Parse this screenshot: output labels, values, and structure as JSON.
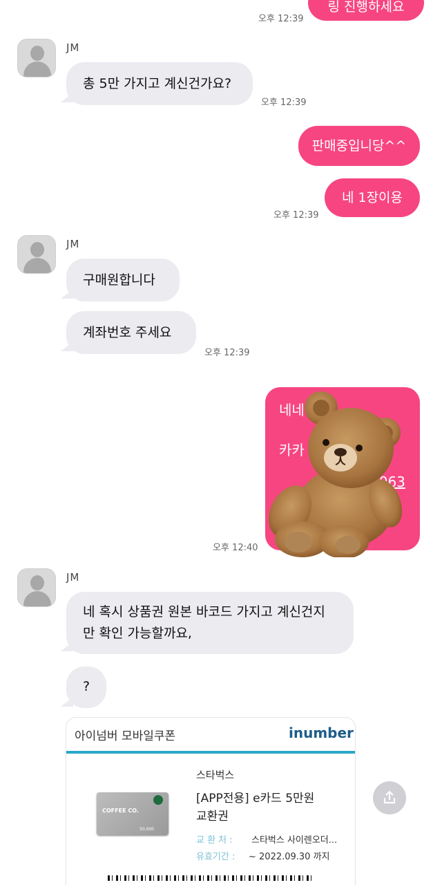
{
  "messages": {
    "top_out_partial": "링 진행하세요",
    "time_top": "오후 12:39",
    "sender1": "JM",
    "in1": "총 5만 가지고 계신건가요?",
    "time1": "오후 12:39",
    "out1": "판매중입니당^^",
    "out2": "네 1장이용",
    "time2": "오후 12:39",
    "sender2": "JM",
    "in2": "구매원합니다",
    "in3": "계좌번호 주세요",
    "time3": "오후 12:39",
    "out_img_line1": "네네",
    "out_img_line2": "카카",
    "out_img_line3": "3063",
    "time4": "오후 12:40",
    "sender3": "JM",
    "in4_line1": "네 혹시 상품권 원본 바코드 가지고 계신건지",
    "in4_line2": "만 확인 가능할까요,",
    "in5": "?"
  },
  "coupon": {
    "header_title": "아이넘버 모바일쿠폰",
    "logo_text": "inumber",
    "brand": "스타벅스",
    "product_line1": "[APP전용] e카드 5만원",
    "product_line2": "교환권",
    "exchange_label": "교 환 처 :",
    "exchange_value": "스타벅스 사이렌오더...",
    "validity_label": "유효기간 :",
    "validity_value": "~ 2022.09.30 까지",
    "card_text": "COFFEE CO.",
    "card_amount": "50,000"
  },
  "icons": {
    "share": "share-icon",
    "avatar": "default-avatar-icon",
    "teddy": "teddy-bear-sticker"
  },
  "colors": {
    "outgoing_bubble": "#f74582",
    "incoming_bubble": "#ebebf0",
    "coupon_accent": "#29a7c9"
  }
}
